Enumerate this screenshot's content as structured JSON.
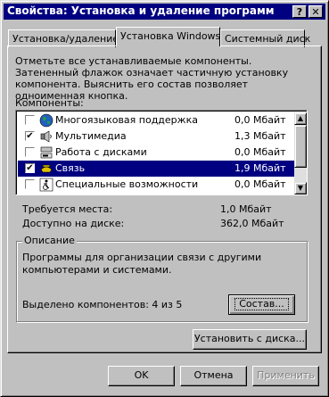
{
  "window": {
    "title": "Свойства: Установка и удаление программ",
    "help_label": "?",
    "close_label": "✕"
  },
  "tabs": [
    {
      "label": "Установка/удаление",
      "active": false
    },
    {
      "label": "Установка Windows",
      "active": true
    },
    {
      "label": "Системный диск",
      "active": false
    }
  ],
  "instructions": "Отметьте все устанавливаемые компоненты. Затененный флажок означает частичную установку компонента. Выяснить его состав позволяет одноименная кнопка.",
  "components": {
    "label": "Компоненты:",
    "items": [
      {
        "name": "Многоязыковая поддержка",
        "size": "0,0 Мбайт",
        "checked": false,
        "selected": false,
        "icon": "globe-icon"
      },
      {
        "name": "Мультимедиа",
        "size": "1,3 Мбайт",
        "checked": true,
        "selected": false,
        "icon": "speaker-icon"
      },
      {
        "name": "Работа с дисками",
        "size": "0,0 Мбайт",
        "checked": false,
        "selected": false,
        "icon": "disks-icon"
      },
      {
        "name": "Связь",
        "size": "1,9 Мбайт",
        "checked": true,
        "selected": true,
        "icon": "phone-icon"
      },
      {
        "name": "Специальные возможности",
        "size": "0,0 Мбайт",
        "checked": false,
        "selected": false,
        "icon": "accessibility-icon"
      }
    ]
  },
  "space": {
    "required_label": "Требуется места:",
    "required_value": "1,0 Мбайт",
    "available_label": "Доступно на диске:",
    "available_value": "362,0 Мбайт"
  },
  "description": {
    "group_label": "Описание",
    "text": "Программы для организации связи с другими компьютерами и системами.",
    "selected_count": "Выделено компонентов: 4 из 5",
    "details_button": "Состав..."
  },
  "install_from_disk_button": "Установить с диска...",
  "footer": {
    "ok_label": "OK",
    "cancel_label": "Отмена",
    "apply_label": "Применить"
  }
}
